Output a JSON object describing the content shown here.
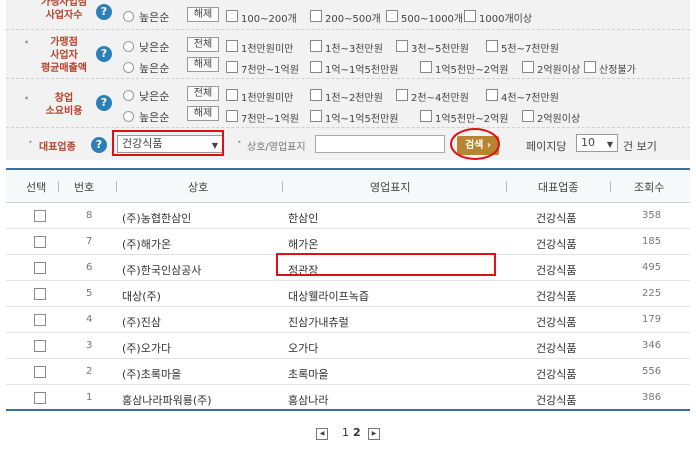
{
  "filters": {
    "row1": {
      "label_top": "가맹사업점",
      "label": "사업자수",
      "radio_high": "높은순",
      "all_button": "해제",
      "options": [
        "100~200개",
        "200~500개",
        "500~1000개",
        "1000개이상"
      ]
    },
    "row2": {
      "label1": "가맹점",
      "label2": "사업자",
      "label3": "평균매출액",
      "radio_low": "낮은순",
      "radio_high": "높은순",
      "btn_all": "전체",
      "btn_clear": "해제",
      "options_line1": [
        "1천만원미만",
        "1천~3천만원",
        "3천~5천만원",
        "5천~7천만원"
      ],
      "options_line2": [
        "7천만~1억원",
        "1억~1억5천만원",
        "1억5천만~2억원",
        "2억원이상",
        "산정불가"
      ]
    },
    "row3": {
      "label1": "창업",
      "label2": "소요비용",
      "radio_low": "낮은순",
      "radio_high": "높은순",
      "btn_all": "전체",
      "btn_clear": "해제",
      "options_line1": [
        "1천만원미만",
        "1천~2천만원",
        "2천~4천만원",
        "4천~7천만원"
      ],
      "options_line2": [
        "7천만~1억원",
        "1억~1억5천만원",
        "1억5천만~2억원",
        "2억원이상"
      ]
    },
    "industry_label": "대표업종",
    "industry_value": "건강식품",
    "name_label": "상호/영업표지",
    "name_input_value": "",
    "search_button": "검색",
    "per_page_label": "페이지당",
    "per_page_value": "10",
    "per_page_unit": "건 보기"
  },
  "table": {
    "headers": [
      "선택",
      "번호",
      "상호",
      "영업표지",
      "대표업종",
      "조회수"
    ],
    "rows": [
      {
        "num": "8",
        "company": "(주)농협한삼인",
        "brand": "한삼인",
        "industry": "건강식품",
        "views": "358"
      },
      {
        "num": "7",
        "company": "(주)해가온",
        "brand": "해가온",
        "industry": "건강식품",
        "views": "185"
      },
      {
        "num": "6",
        "company": "(주)한국인삼공사",
        "brand": "정관장",
        "industry": "건강식품",
        "views": "495"
      },
      {
        "num": "5",
        "company": "대상(주)",
        "brand": "대상웰라이프녹즙",
        "industry": "건강식품",
        "views": "225"
      },
      {
        "num": "4",
        "company": "(주)진삼",
        "brand": "진삼가내츄럴",
        "industry": "건강식품",
        "views": "179"
      },
      {
        "num": "3",
        "company": "(주)오가다",
        "brand": "오가다",
        "industry": "건강식품",
        "views": "346"
      },
      {
        "num": "2",
        "company": "(주)초록마을",
        "brand": "초록마을",
        "industry": "건강식품",
        "views": "556"
      },
      {
        "num": "1",
        "company": "홍삼나라파워룡(주)",
        "brand": "홍삼나라",
        "industry": "건강식품",
        "views": "386"
      }
    ]
  },
  "pagination": {
    "prev": "◀",
    "pages": [
      "1",
      "2"
    ],
    "next": "▶"
  },
  "colors": {
    "accent": "#3e6f9e",
    "label": "#b5442b",
    "highlight": "#e0101b",
    "search_btn": "#b8842f"
  }
}
